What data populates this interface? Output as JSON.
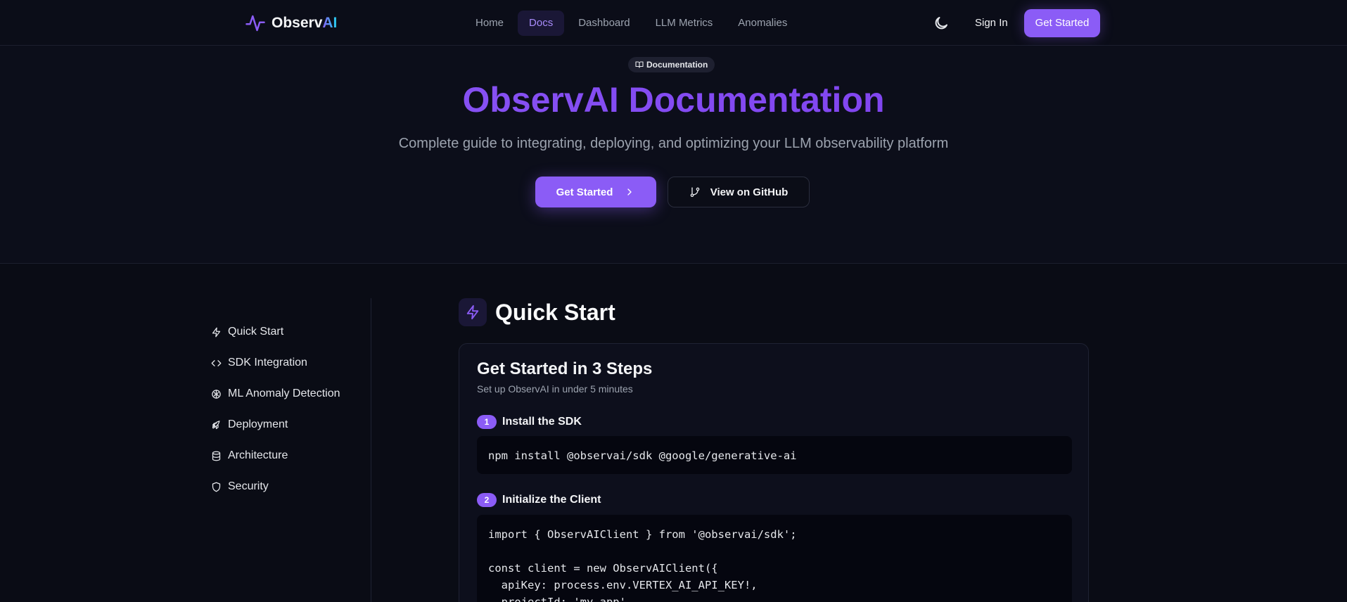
{
  "nav": {
    "logo_primary": "Observ",
    "logo_accent": "AI",
    "links": [
      "Home",
      "Docs",
      "Dashboard",
      "LLM Metrics",
      "Anomalies"
    ],
    "active": "Docs",
    "sign_in": "Sign In",
    "cta": "Get Started"
  },
  "hero": {
    "badge": "Documentation",
    "title": "ObservAI Documentation",
    "subtitle": "Complete guide to integrating, deploying, and optimizing your LLM observability platform",
    "primary_button": "Get Started",
    "secondary_button": "View on GitHub"
  },
  "sidebar": {
    "items": [
      {
        "label": "Quick Start",
        "icon": "zap-icon"
      },
      {
        "label": "SDK Integration",
        "icon": "code-icon"
      },
      {
        "label": "ML Anomaly Detection",
        "icon": "brain-icon"
      },
      {
        "label": "Deployment",
        "icon": "rocket-icon"
      },
      {
        "label": "Architecture",
        "icon": "database-icon"
      },
      {
        "label": "Security",
        "icon": "shield-icon"
      }
    ]
  },
  "main": {
    "section_title": "Quick Start",
    "card": {
      "title": "Get Started in 3 Steps",
      "subtitle": "Set up ObservAI in under 5 minutes",
      "steps": [
        {
          "number": "1",
          "title": "Install the SDK",
          "code": "npm install @observai/sdk @google/generative-ai"
        },
        {
          "number": "2",
          "title": "Initialize the Client",
          "code": "import { ObservAIClient } from '@observai/sdk';\n\nconst client = new ObservAIClient({\n  apiKey: process.env.VERTEX_AI_API_KEY!,\n  projectId: 'my-app',"
        }
      ]
    }
  },
  "colors": {
    "accent": "#8b5cf6",
    "background": "#0a0c15"
  }
}
